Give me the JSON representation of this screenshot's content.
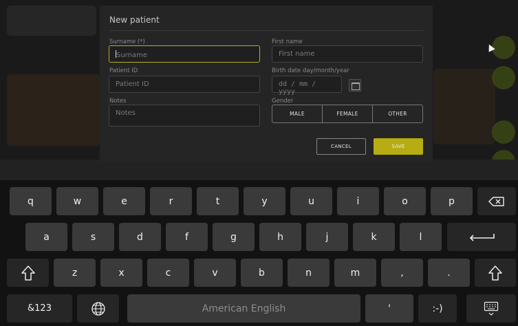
{
  "dialog": {
    "title": "New patient",
    "surname": {
      "label": "Surname (*)",
      "placeholder": "Surname"
    },
    "first_name": {
      "label": "First name",
      "placeholder": "First name"
    },
    "patient_id": {
      "label": "Patient ID",
      "placeholder": "Patient ID"
    },
    "birth_date": {
      "label": "Birth date day/month/year",
      "placeholder": "dd / mm / yyyy"
    },
    "notes": {
      "label": "Notes",
      "placeholder": "Notes"
    },
    "gender": {
      "label": "Gender",
      "options": [
        "MALE",
        "FEMALE",
        "OTHER"
      ]
    },
    "cancel_label": "CANCEL",
    "save_label": "SAVE"
  },
  "keyboard": {
    "row1": [
      "q",
      "w",
      "e",
      "r",
      "t",
      "y",
      "u",
      "i",
      "o",
      "p"
    ],
    "row2": [
      "a",
      "s",
      "d",
      "f",
      "g",
      "h",
      "j",
      "k",
      "l"
    ],
    "row3": [
      "z",
      "x",
      "c",
      "v",
      "b",
      "n",
      "m",
      ",",
      "."
    ],
    "symbols_label": "&123",
    "space_label": "American English",
    "apostrophe": "'",
    "smiley": ":-)"
  },
  "colors": {
    "accent": "#b5ad12",
    "focus_border": "#b5b020"
  }
}
